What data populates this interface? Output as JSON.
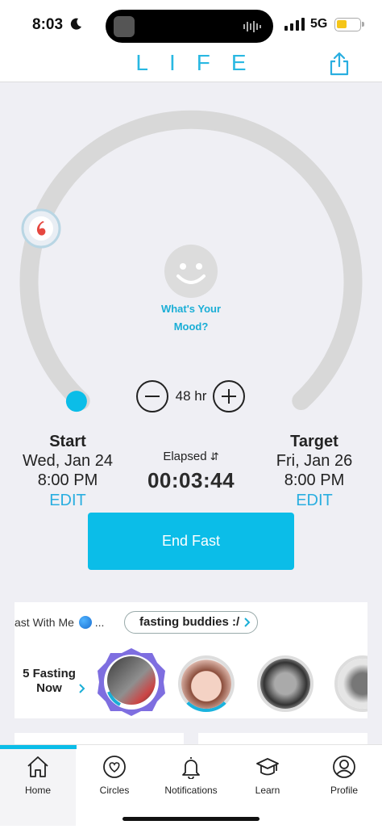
{
  "status_bar": {
    "time": "8:03",
    "network": "5G",
    "battery_level": 0.45,
    "icons": [
      "moon-icon",
      "signal-icon",
      "battery-icon"
    ]
  },
  "header": {
    "logo": "LIFE",
    "share_icon": "share-icon"
  },
  "timer": {
    "mood_label_line1": "What's Your",
    "mood_label_line2": "Mood?",
    "duration": "48 hr",
    "progress": 0.0,
    "start": {
      "title": "Start",
      "date": "Wed, Jan 24",
      "time": "8:00 PM",
      "edit": "EDIT"
    },
    "target": {
      "title": "Target",
      "date": "Fri, Jan 26",
      "time": "8:00 PM",
      "edit": "EDIT"
    },
    "elapsed_label": "Elapsed",
    "elapsed_sort_icon": "⇵",
    "elapsed_time": "00:03:44",
    "end_button": "End Fast"
  },
  "social": {
    "tab_label": "ast With Me",
    "tab_ellipsis": "...",
    "chip_label": "fasting buddies :/",
    "fasting_count_line1": "5 Fasting",
    "fasting_count_line2": "Now"
  },
  "tab_bar": {
    "items": [
      {
        "label": "Home",
        "icon": "home-icon"
      },
      {
        "label": "Circles",
        "icon": "circles-heart-icon"
      },
      {
        "label": "Notifications",
        "icon": "bell-icon"
      },
      {
        "label": "Learn",
        "icon": "graduation-cap-icon"
      },
      {
        "label": "Profile",
        "icon": "profile-icon"
      }
    ]
  },
  "colors": {
    "accent": "#0bbde8",
    "logo": "#29b8e2",
    "ring": "#d8d8d8",
    "background": "#efeff4"
  }
}
